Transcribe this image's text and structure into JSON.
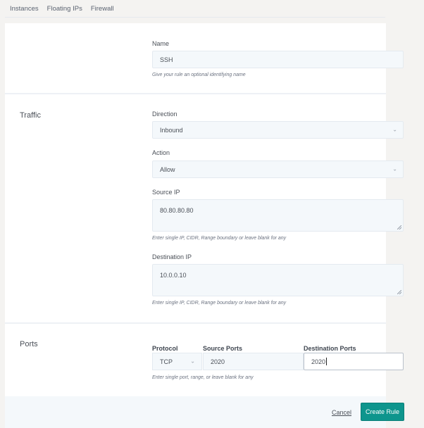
{
  "nav": {
    "tabs": [
      {
        "label": "Instances"
      },
      {
        "label": "Floating IPs"
      },
      {
        "label": "Firewall"
      }
    ]
  },
  "form": {
    "name": {
      "label": "Name",
      "value": "SSH",
      "hint": "Give your rule an optional identifying name"
    },
    "traffic": {
      "title": "Traffic",
      "direction": {
        "label": "Direction",
        "value": "Inbound"
      },
      "action": {
        "label": "Action",
        "value": "Allow"
      },
      "source_ip": {
        "label": "Source IP",
        "value": "80.80.80.80",
        "hint": "Enter single IP, CIDR, Range boundary or leave blank for any"
      },
      "destination_ip": {
        "label": "Destination IP",
        "value": "10.0.0.10",
        "hint": "Enter single IP, CIDR, Range boundary or leave blank for any"
      }
    },
    "ports": {
      "title": "Ports",
      "protocol": {
        "label": "Protocol",
        "value": "TCP"
      },
      "source_ports": {
        "label": "Source Ports",
        "value": "2020"
      },
      "destination_ports": {
        "label": "Destination Ports",
        "value": "2020"
      },
      "hint": "Enter single port, range, or leave blank for any"
    }
  },
  "footer": {
    "cancel_label": "Cancel",
    "create_label": "Create Rule",
    "accent_color": "#0e958d"
  },
  "icons": {
    "chevron": "⌄"
  }
}
